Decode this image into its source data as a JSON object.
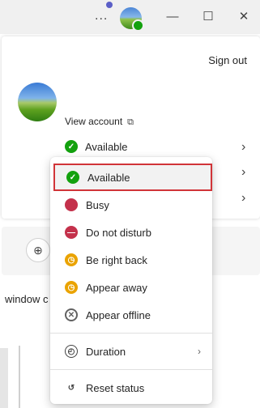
{
  "titlebar": {
    "more_label": "...",
    "minimize_glyph": "—",
    "maximize_glyph": "☐",
    "close_glyph": "✕"
  },
  "account": {
    "signout_label": "Sign out",
    "view_account_label": "View account",
    "current_status": "Available"
  },
  "background": {
    "partial_text": "window c"
  },
  "status_menu": {
    "items": [
      {
        "label": "Available",
        "icon": "available-icon",
        "selected": true
      },
      {
        "label": "Busy",
        "icon": "busy-icon"
      },
      {
        "label": "Do not disturb",
        "icon": "do-not-disturb-icon"
      },
      {
        "label": "Be right back",
        "icon": "be-right-back-icon"
      },
      {
        "label": "Appear away",
        "icon": "appear-away-icon"
      },
      {
        "label": "Appear offline",
        "icon": "appear-offline-icon"
      }
    ],
    "duration_label": "Duration",
    "reset_label": "Reset status"
  },
  "colors": {
    "available": "#13a10e",
    "busy": "#c4314b",
    "away": "#eaa300",
    "selection_border": "#d13438"
  }
}
